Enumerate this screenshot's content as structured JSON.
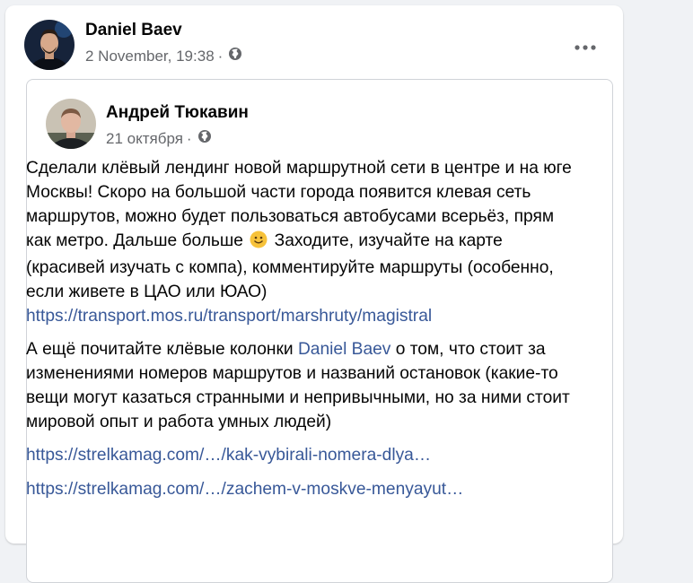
{
  "post": {
    "author": "Daniel Baev",
    "date": "2 November, 19:38",
    "separator": "·",
    "privacy_icon": "globe-icon",
    "more_icon": "more-options-icon"
  },
  "shared": {
    "author": "Андрей Тюкавин",
    "date": "21 октября",
    "separator": "·",
    "privacy_icon": "globe-icon",
    "p1": "Сделали клёвый лендинг новой маршрутной сети в центре и на юге Москвы! Скоро на большой части города появится клевая сеть маршрутов, можно будет пользоваться автобусами всерьёз, прям как метро. Дальше больше",
    "p1_emoji": "slightly-smiling-face-emoji",
    "p1_cont": " Заходите, изучайте на карте (красивей изучать с компа), комментируйте маршруты (особенно, если живете в ЦАО или ЮАО)",
    "link1": "https://transport.mos.ru/transport/marshruty/magistral",
    "p2_start": "А ещё почитайте клёвые колонки ",
    "p2_mention": "Daniel Baev",
    "p2_end": " о том, что стоит за изменениями номеров маршрутов и названий остановок (какие-то вещи могут казаться странными и непривычными, но за ними стоит мировой опыт и работа умных людей)",
    "link2": "https://strelkamag.com/…/kak-vybirali-nomera-dlya…",
    "link3": "https://strelkamag.com/…/zachem-v-moskve-menyayut…"
  },
  "colors": {
    "link": "#385898",
    "meta": "#65676b",
    "text": "#050505"
  }
}
